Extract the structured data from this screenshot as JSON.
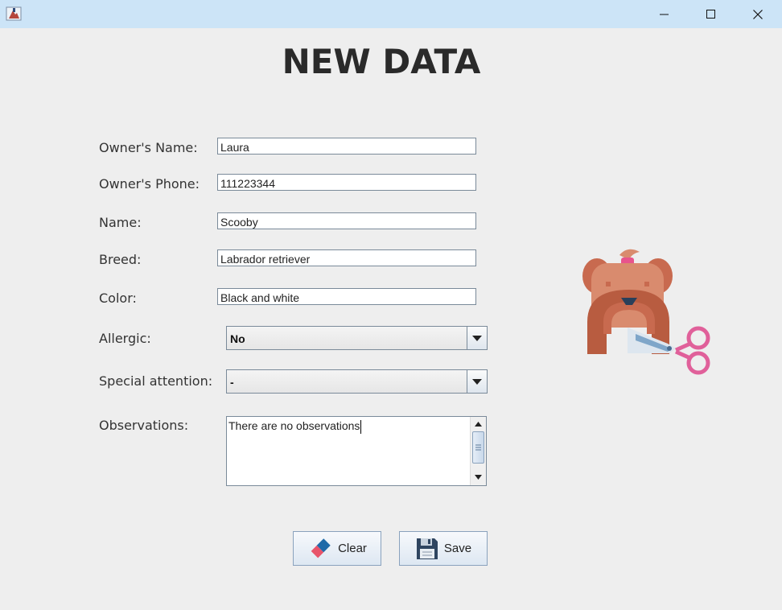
{
  "window": {
    "icon": "java-app-icon",
    "controls": [
      "minimize-icon",
      "maximize-icon",
      "close-icon"
    ]
  },
  "form": {
    "heading": "NEW DATA",
    "owner_name": {
      "label": "Owner's Name:",
      "value": "Laura"
    },
    "owner_phone": {
      "label": "Owner's Phone:",
      "value": "111223344"
    },
    "name": {
      "label": "Name:",
      "value": "Scooby"
    },
    "breed": {
      "label": "Breed:",
      "value": "Labrador retriever"
    },
    "color": {
      "label": "Color:",
      "value": "Black and white"
    },
    "allergic": {
      "label": "Allergic:",
      "selected": "No"
    },
    "special_attention": {
      "label": "Special attention:",
      "selected": "-"
    },
    "observations": {
      "label": "Observations:",
      "value": "There are no observations"
    }
  },
  "buttons": {
    "clear": {
      "label": "Clear",
      "icon": "eraser-icon"
    },
    "save": {
      "label": "Save",
      "icon": "floppy-disk-icon"
    }
  },
  "illustration": {
    "icon": "dog-grooming-icon"
  },
  "colors": {
    "titlebar": "#cce4f7",
    "background": "#eeeeee",
    "dog_ears": "#c86a4f",
    "dog_face": "#d98b6e",
    "scissors": "#e0609a"
  }
}
